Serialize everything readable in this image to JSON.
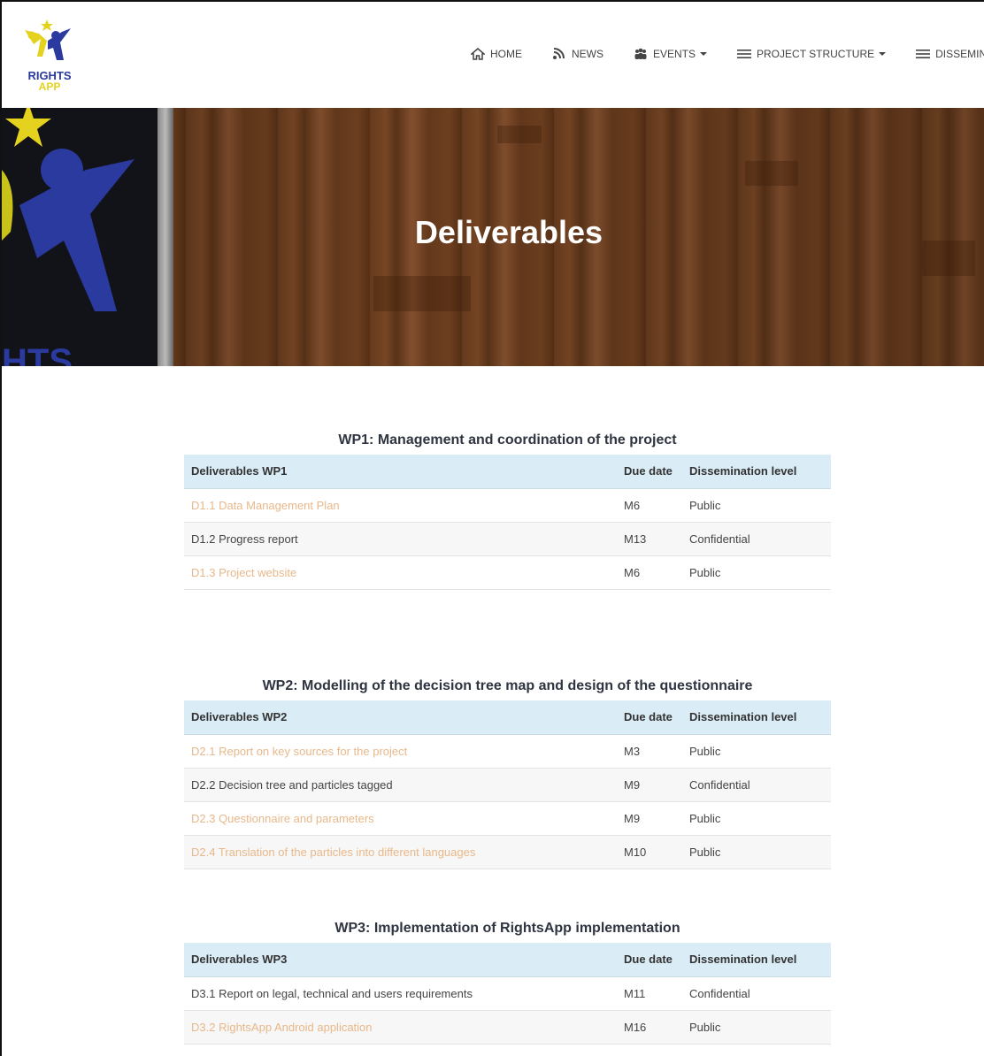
{
  "brand": {
    "line1": "RIGHTS",
    "line2": "APP",
    "colors": {
      "blue": "#2a3a9e",
      "yellow": "#e4d21e"
    }
  },
  "nav": [
    {
      "label": "HOME",
      "icon": "home-icon",
      "dropdown": false
    },
    {
      "label": "NEWS",
      "icon": "rss-icon",
      "dropdown": false
    },
    {
      "label": "EVENTS",
      "icon": "group-icon",
      "dropdown": true
    },
    {
      "label": "PROJECT STRUCTURE",
      "icon": "list-icon",
      "dropdown": true
    },
    {
      "label": "DISSEMINATION",
      "icon": "list-icon",
      "dropdown": true
    }
  ],
  "hero": {
    "title": "Deliverables"
  },
  "columns": {
    "due": "Due date",
    "level": "Dissemination level"
  },
  "sections": [
    {
      "title": "WP1: Management and coordination of the project",
      "header": "Deliverables WP1",
      "rows": [
        {
          "name": "D1.1 Data Management Plan",
          "due": "M6",
          "level": "Public",
          "link": true
        },
        {
          "name": "D1.2 Progress report",
          "due": "M13",
          "level": "Confidential",
          "link": false
        },
        {
          "name": "D1.3 Project website",
          "due": "M6",
          "level": "Public",
          "link": true
        }
      ]
    },
    {
      "title": "WP2: Modelling of the decision tree map and design of the questionnaire",
      "header": "Deliverables WP2",
      "rows": [
        {
          "name": "D2.1 Report on key sources for the project",
          "due": "M3",
          "level": "Public",
          "link": true
        },
        {
          "name": "D2.2 Decision tree and particles tagged",
          "due": "M9",
          "level": "Confidential",
          "link": false
        },
        {
          "name": "D2.3 Questionnaire and parameters",
          "due": "M9",
          "level": "Public",
          "link": true
        },
        {
          "name": "D2.4 Translation of the particles into different languages",
          "due": "M10",
          "level": "Public",
          "link": true
        }
      ]
    },
    {
      "title": "WP3: Implementation of RightsApp implementation",
      "header": "Deliverables WP3",
      "rows": [
        {
          "name": "D3.1 Report on legal, technical and users requirements",
          "due": "M11",
          "level": "Confidential",
          "link": false
        },
        {
          "name": "D3.2 RightsApp Android application",
          "due": "M16",
          "level": "Public",
          "link": true
        }
      ]
    }
  ]
}
